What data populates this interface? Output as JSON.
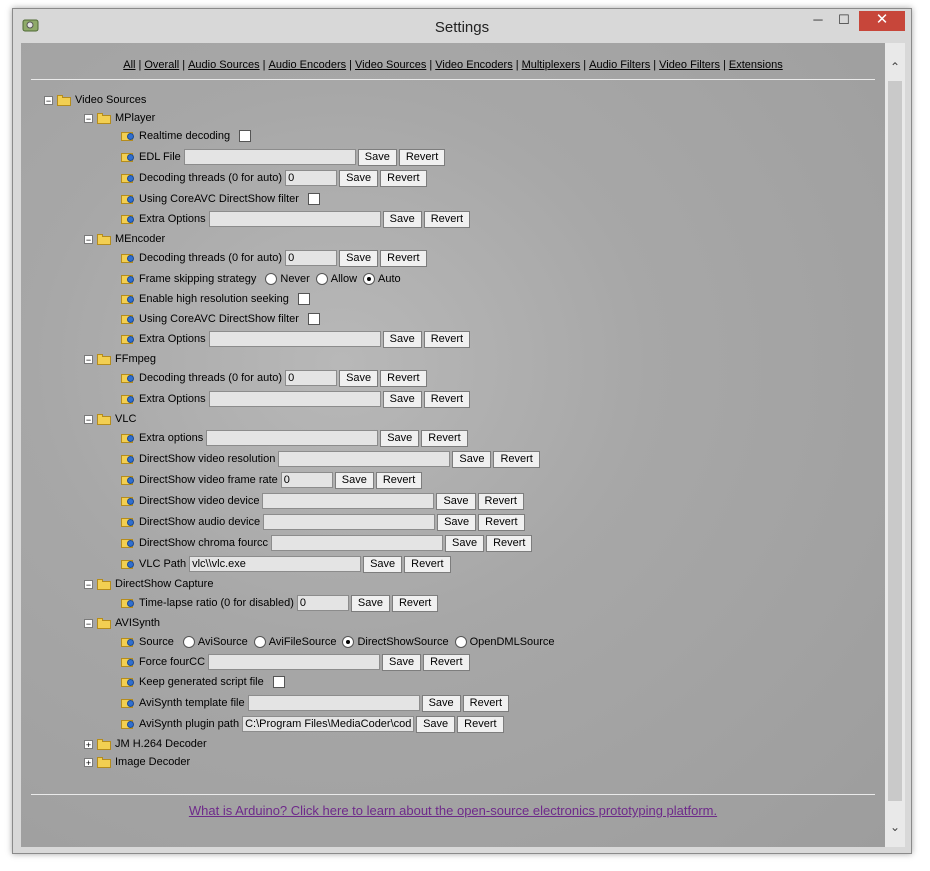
{
  "window": {
    "title": "Settings",
    "minimize": "─",
    "maximize": "☐",
    "close": "✕"
  },
  "nav": [
    "All",
    "Overall",
    "Audio Sources",
    "Audio Encoders",
    "Video Sources",
    "Video Encoders",
    "Multiplexers",
    "Audio Filters",
    "Video Filters",
    "Extensions"
  ],
  "tree": {
    "root": "Video Sources",
    "mplayer": {
      "label": "MPlayer",
      "realtime": "Realtime decoding",
      "edl": "EDL File",
      "threads": "Decoding threads (0 for auto)",
      "threads_value": "0",
      "coreavc": "Using CoreAVC DirectShow filter",
      "extra": "Extra Options"
    },
    "mencoder": {
      "label": "MEncoder",
      "threads": "Decoding threads (0 for auto)",
      "threads_value": "0",
      "frameskip": "Frame skipping strategy",
      "frameskip_options": [
        "Never",
        "Allow",
        "Auto"
      ],
      "hires": "Enable high resolution seeking",
      "coreavc": "Using CoreAVC DirectShow filter",
      "extra": "Extra Options"
    },
    "ffmpeg": {
      "label": "FFmpeg",
      "threads": "Decoding threads (0 for auto)",
      "threads_value": "0",
      "extra": "Extra Options"
    },
    "vlc": {
      "label": "VLC",
      "extra": "Extra options",
      "ds_res": "DirectShow video resolution",
      "ds_fps": "DirectShow video frame rate",
      "ds_fps_value": "0",
      "ds_vdev": "DirectShow video device",
      "ds_adev": "DirectShow audio device",
      "ds_chroma": "DirectShow chroma fourcc",
      "path": "VLC Path",
      "path_value": "vlc\\\\vlc.exe"
    },
    "dshow": {
      "label": "DirectShow Capture",
      "timelapse": "Time-lapse ratio (0 for disabled)",
      "timelapse_value": "0"
    },
    "avisynth": {
      "label": "AVISynth",
      "source": "Source",
      "source_options": [
        "AviSource",
        "AviFileSource",
        "DirectShowSource",
        "OpenDMLSource"
      ],
      "fourcc": "Force fourCC",
      "keep": "Keep generated script file",
      "template": "AviSynth template file",
      "plugin": "AviSynth plugin path",
      "plugin_value": "C:\\Program Files\\MediaCoder\\codecs"
    },
    "jm": {
      "label": "JM H.264 Decoder"
    },
    "image": {
      "label": "Image Decoder"
    }
  },
  "buttons": {
    "save": "Save",
    "revert": "Revert"
  },
  "expanders": {
    "minus": "−",
    "plus": "+"
  },
  "footer": {
    "link": "What is Arduino? Click here to learn about the open-source electronics prototyping platform."
  },
  "scroll": {
    "up": "⌃",
    "down": "⌄"
  },
  "colors": {
    "content_bg": "#a7a7a7",
    "close_button": "#c7463a",
    "footer_link": "#6e2a8a",
    "folder": "#f2cf52"
  }
}
